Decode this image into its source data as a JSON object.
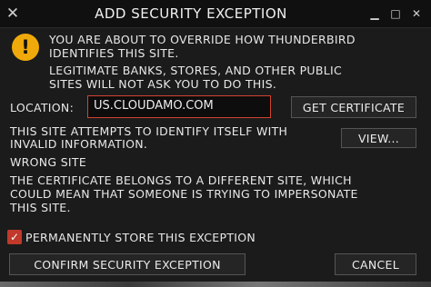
{
  "window": {
    "title": "ADD SECURITY EXCEPTION",
    "close_glyph": "✕",
    "minimize_glyph": "▁",
    "maximize_glyph": "□",
    "close_right_glyph": "✕"
  },
  "warning_icon": {
    "name": "warning-icon",
    "glyph": "!",
    "color": "#f0a90a"
  },
  "message": {
    "line1": "YOU ARE ABOUT TO OVERRIDE HOW THUNDERBIRD",
    "line2": "IDENTIFIES THIS SITE.",
    "line3": "LEGITIMATE BANKS, STORES, AND OTHER PUBLIC",
    "line4": "SITES WILL NOT ASK YOU TO DO THIS."
  },
  "location": {
    "label": "LOCATION:",
    "value": "US.CLOUDAMO.COM",
    "get_certificate_label": "GET CERTIFICATE"
  },
  "status": {
    "line1": "THIS SITE ATTEMPTS TO IDENTIFY ITSELF WITH",
    "line2": "INVALID INFORMATION.",
    "view_label": "VIEW...",
    "heading": "WRONG SITE",
    "detail1": "THE CERTIFICATE BELONGS TO A DIFFERENT SITE, WHICH",
    "detail2": "COULD MEAN THAT SOMEONE IS TRYING TO IMPERSONATE",
    "detail3": "THIS SITE."
  },
  "permanent": {
    "checked": true,
    "label": "PERMANENTLY STORE THIS EXCEPTION"
  },
  "buttons": {
    "confirm_label": "CONFIRM SECURITY EXCEPTION",
    "cancel_label": "CANCEL"
  },
  "colors": {
    "accent": "#c0392b",
    "input_border": "#d24430",
    "background": "#1b1b1b"
  }
}
